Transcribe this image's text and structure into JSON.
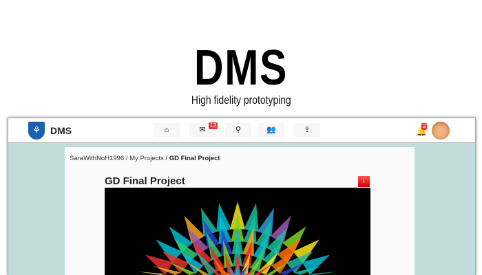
{
  "hero": {
    "title": "DMS",
    "subtitle": "High fidelity prototyping"
  },
  "nav": {
    "brand": "DMS",
    "messages_badge": "13",
    "notifications_badge": "2",
    "icons": [
      "home-icon",
      "mail-icon",
      "search-icon",
      "users-icon",
      "upload-icon"
    ]
  },
  "breadcrumb": [
    "SaraWithNoH1996",
    "My Projects",
    "GD Final Project"
  ],
  "project": {
    "title": "GD Final Project"
  },
  "colors": {
    "teal": "#c2dcdc",
    "brand_blue": "#1b5fae",
    "badge_red": "#e03a3a"
  }
}
